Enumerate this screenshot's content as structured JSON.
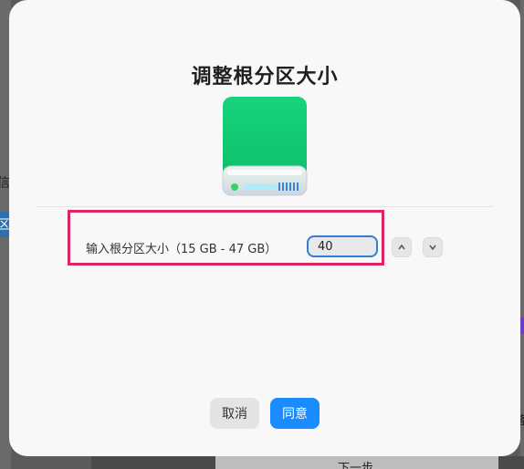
{
  "background": {
    "left_char_1": "信",
    "left_char_2": "区",
    "right_char": "备",
    "next_button_label": "下一步"
  },
  "dialog": {
    "title": "调整根分区大小",
    "field_label": "输入根分区大小（15 GB - 47 GB）",
    "size_value": "40",
    "cancel_label": "取消",
    "confirm_label": "同意"
  },
  "colors": {
    "accent": "#1a8cff",
    "highlight": "#e0245e",
    "drive_green": "#12c772"
  },
  "icons": {
    "drive": "hard-drive-icon",
    "increment": "chevron-up-icon",
    "decrement": "chevron-down-icon"
  }
}
